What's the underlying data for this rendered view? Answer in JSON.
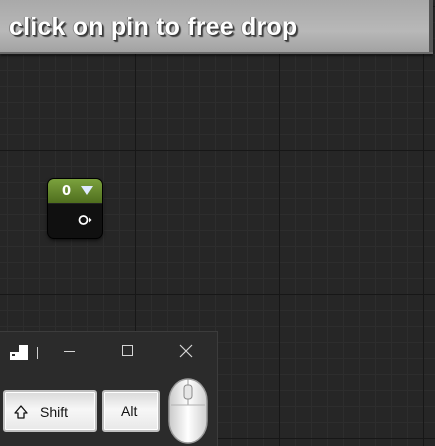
{
  "banner": {
    "text": "click on pin to free drop"
  },
  "node": {
    "title": "0",
    "header_color": "#6b8f32",
    "dropdown_icon": "triangle-down-icon",
    "pin_icon": "exec-pin-icon"
  },
  "keyboard": {
    "window_icon": "keyboard-app-icon",
    "minimize_icon": "minimize-icon",
    "maximize_icon": "maximize-icon",
    "close_icon": "close-icon",
    "keys": [
      {
        "label": "Shift",
        "icon": "shift-arrow-icon"
      },
      {
        "label": "Alt"
      }
    ],
    "mouse_icon": "mouse-icon"
  }
}
